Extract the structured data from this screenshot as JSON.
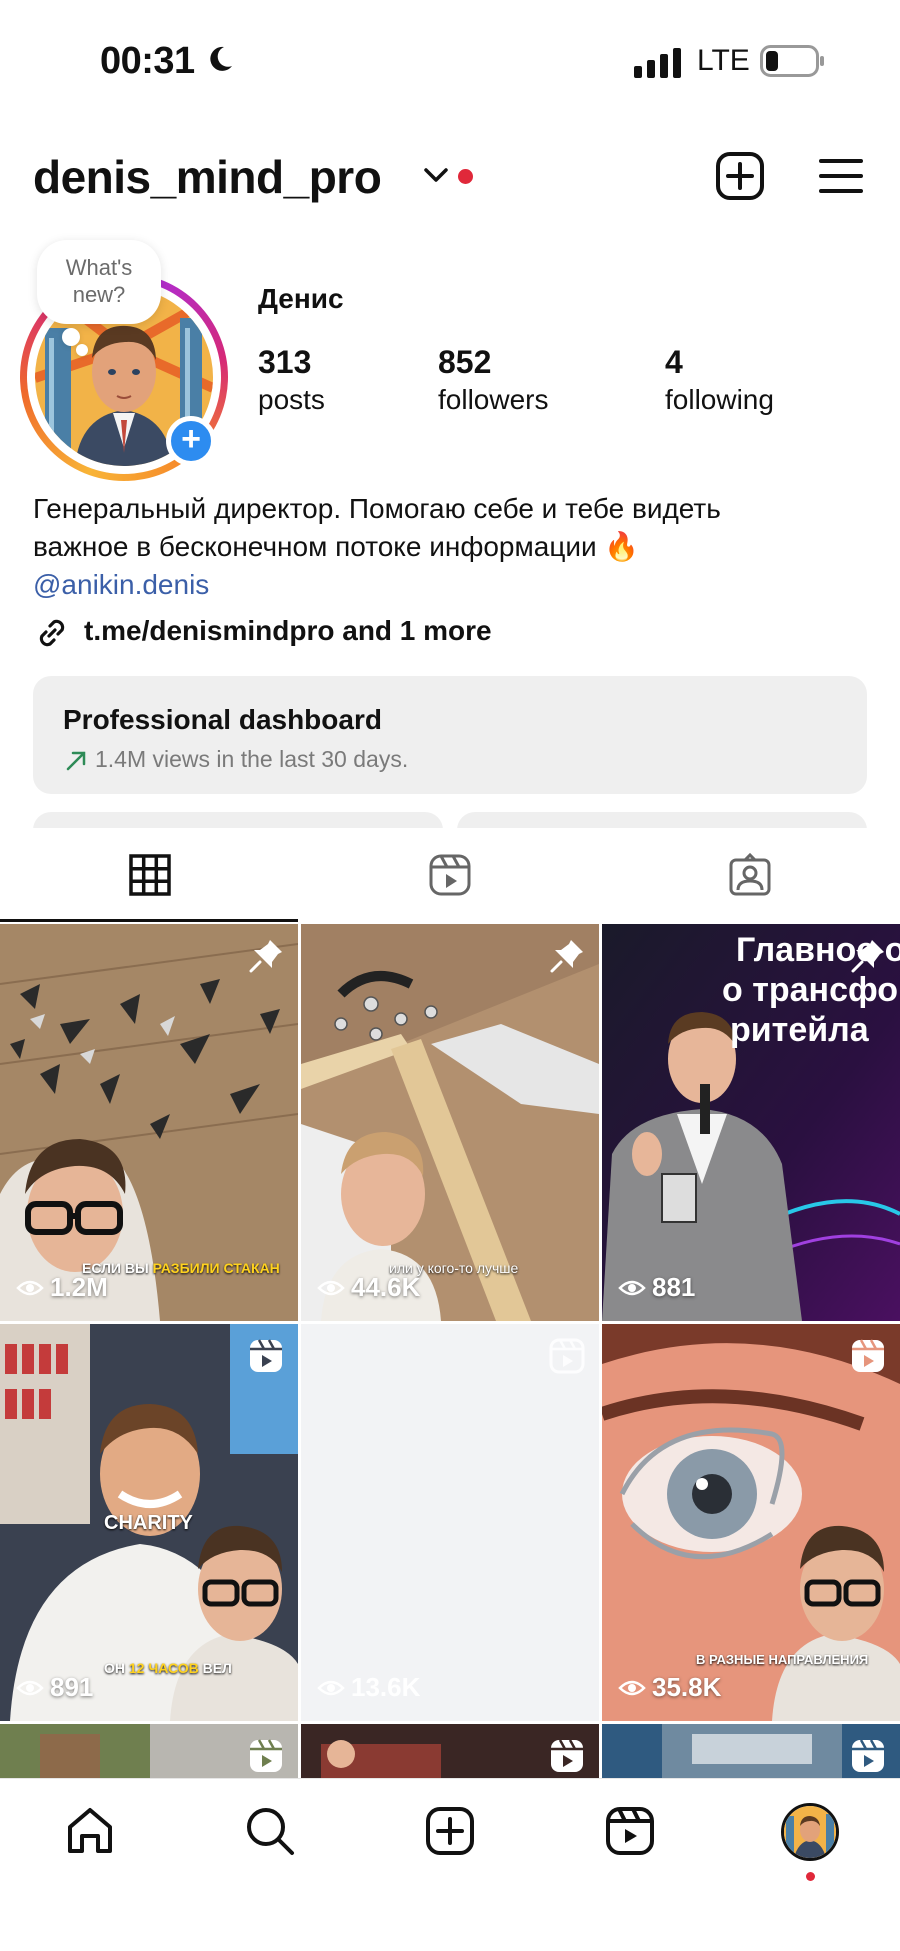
{
  "status_bar": {
    "time": "00:31",
    "network": "LTE"
  },
  "header": {
    "username": "denis_mind_pro"
  },
  "note": {
    "text_line1": "What's",
    "text_line2": "new?"
  },
  "profile": {
    "name": "Денис",
    "stats": [
      {
        "value": "313",
        "label": "posts"
      },
      {
        "value": "852",
        "label": "followers"
      },
      {
        "value": "4",
        "label": "following"
      }
    ],
    "bio_line1": "Генеральный директор. Помогаю себе и тебе видеть",
    "bio_line2": "важное в бесконечном потоке информации 🔥",
    "bio_handle": "@anikin.denis",
    "link_text": "t.me/denismindpro and 1 more"
  },
  "dashboard": {
    "title": "Professional dashboard",
    "subtitle": "1.4M views in the last 30 days."
  },
  "tabs": [
    "posts-grid",
    "reels",
    "tagged"
  ],
  "grid": [
    {
      "views": "1.2M",
      "corner": "pin-icon",
      "caption_a": "ЕСЛИ ВЫ ",
      "caption_b": "РАЗБИЛИ СТАКАН"
    },
    {
      "views": "44.6K",
      "corner": "pin-icon",
      "caption_a": "или у кого-то лучше"
    },
    {
      "views": "881",
      "corner": "pin-icon",
      "screen_line1": "Главное о",
      "screen_line2": "о трансфо",
      "screen_line3": "ритейла"
    },
    {
      "views": "891",
      "corner": "reel-icon",
      "caption_a": "CHARITY",
      "caption_b": "ОН ",
      "caption_c": "12 ЧАСОВ",
      "caption_d": " ВЕЛ"
    },
    {
      "views": "13.6K",
      "corner": "reel-icon"
    },
    {
      "views": "35.8K",
      "corner": "reel-icon",
      "caption_a": "В РАЗНЫЕ НАПРАВЛЕНИЯ"
    }
  ],
  "colors": {
    "accent_blue": "#2d8cf0",
    "notification_red": "#e0283a",
    "link_blue": "#3b5fa8"
  }
}
